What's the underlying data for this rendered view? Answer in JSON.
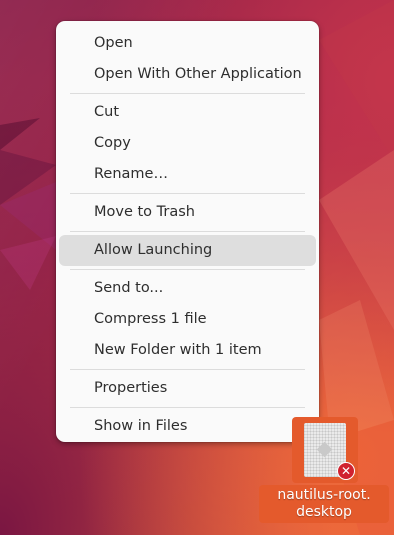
{
  "context_menu": {
    "groups": [
      {
        "items": [
          {
            "label": "Open"
          },
          {
            "label": "Open With Other Application"
          }
        ]
      },
      {
        "items": [
          {
            "label": "Cut"
          },
          {
            "label": "Copy"
          },
          {
            "label": "Rename…"
          }
        ]
      },
      {
        "items": [
          {
            "label": "Move to Trash"
          }
        ]
      },
      {
        "items": [
          {
            "label": "Allow Launching",
            "highlighted": true
          }
        ]
      },
      {
        "items": [
          {
            "label": "Send to..."
          },
          {
            "label": "Compress 1 file"
          },
          {
            "label": "New Folder with 1 item"
          }
        ]
      },
      {
        "items": [
          {
            "label": "Properties"
          }
        ]
      },
      {
        "items": [
          {
            "label": "Show in Files"
          }
        ]
      }
    ]
  },
  "desktop_icon": {
    "label_line1": "nautilus-root.",
    "label_line2": "desktop",
    "badge_icon": "close-icon",
    "selection_color": "#e45a2c"
  },
  "colors": {
    "menu_bg": "#fafafa",
    "hover_bg": "#dedede",
    "badge": "#d0222f"
  }
}
